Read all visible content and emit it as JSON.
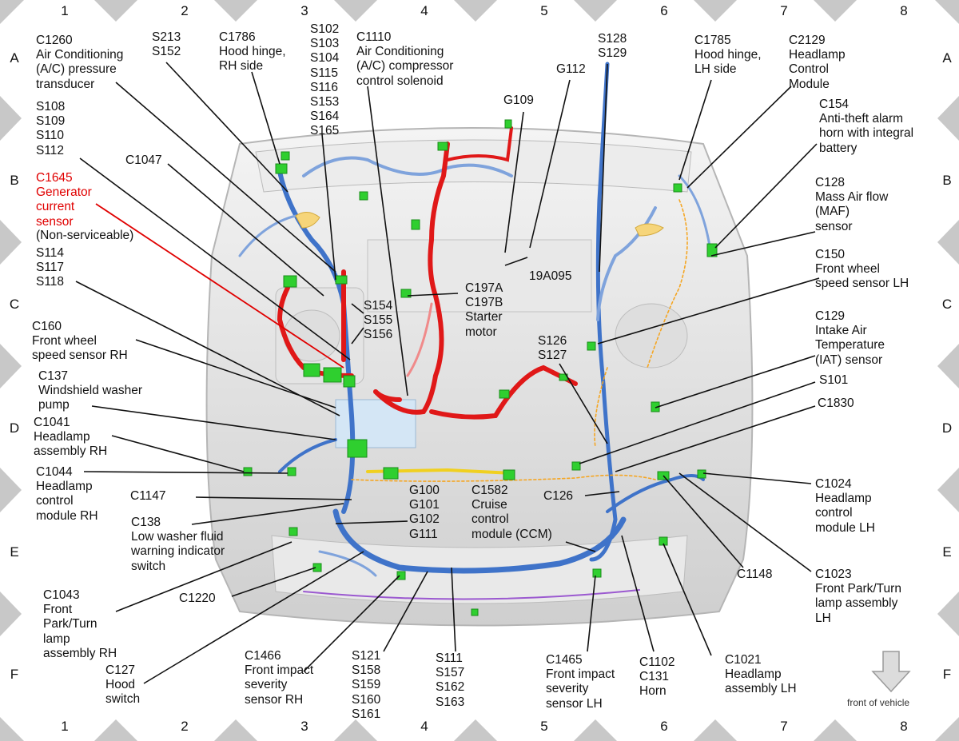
{
  "grid": {
    "columns": [
      "1",
      "2",
      "3",
      "4",
      "5",
      "6",
      "7",
      "8"
    ],
    "rows": [
      "A",
      "B",
      "C",
      "D",
      "E",
      "F"
    ]
  },
  "callouts": {
    "c1260": "C1260\nAir Conditioning\n(A/C) pressure\ntransducer",
    "s213": "S213\nS152",
    "c1786": "C1786\nHood hinge,\nRH side",
    "s102": "S102\nS103\nS104\nS115\nS116\nS153\nS164\nS165",
    "c1110": "C1110\nAir Conditioning\n(A/C) compressor\ncontrol solenoid",
    "g109": "G109",
    "g112": "G112",
    "s128": "S128\nS129",
    "c1785": "C1785\nHood hinge,\nLH side",
    "c2129": "C2129\nHeadlamp\nControl\nModule",
    "s108": "S108\nS109\nS110\nS112",
    "c1047": "C1047",
    "c1645": "C1645\nGenerator\ncurrent\nsensor",
    "c1645_note": "(Non-serviceable)",
    "c154": "C154\nAnti-theft alarm\nhorn with integral\nbattery",
    "c128": "C128\nMass Air flow\n(MAF)\nsensor",
    "s114": "S114\nS117\nS118",
    "a19a095": "19A095",
    "c150": "C150\nFront wheel\nspeed sensor LH",
    "c197": "C197A\nC197B\nStarter\nmotor",
    "s154": "S154\nS155\nS156",
    "c160": "C160\nFront wheel\nspeed sensor RH",
    "c129": "C129\nIntake Air\nTemperature\n(IAT) sensor",
    "s126": "S126\nS127",
    "c137": "C137\nWindshield washer\npump",
    "s101": "S101",
    "c1830": "C1830",
    "c1041": "C1041\nHeadlamp\nassembly RH",
    "c1044": "C1044\nHeadlamp\ncontrol\nmodule RH",
    "c1147": "C1147",
    "g100": "G100\nG101\nG102\nG111",
    "c1582": "C1582\nCruise\ncontrol\nmodule (CCM)",
    "c126": "C126",
    "c1024": "C1024\nHeadlamp\ncontrol\nmodule LH",
    "c138": "C138\nLow washer fluid\nwarning indicator\nswitch",
    "c1148": "C1148",
    "c1023": "C1023\nFront Park/Turn\nlamp assembly\nLH",
    "c1220": "C1220",
    "c1043": "C1043\nFront\nPark/Turn\nlamp\nassembly RH",
    "c127": "C127\nHood\nswitch",
    "c1466": "C1466\nFront impact\nseverity\nsensor RH",
    "s121": "S121\nS158\nS159\nS160\nS161",
    "s111": "S111\nS157\nS162\nS163",
    "c1465": "C1465\nFront impact\nseverity\nsensor LH",
    "c1102": "C1102\nC131\nHorn",
    "c1021": "C1021\nHeadlamp\nassembly LH"
  },
  "legend": {
    "label": "front of vehicle",
    "icon": "arrow-down-icon"
  },
  "colors": {
    "harness_blue": "#3f73c9",
    "harness_blue_light": "#7fa3dc",
    "harness_red": "#e01818",
    "harness_red_light": "#f08a8a",
    "harness_yellow": "#f0d020",
    "harness_orange": "#f5a623",
    "harness_purple": "#9b59d0",
    "connector_green": "#2fcf2f",
    "callout_red": "#e00000",
    "vehicle_body": "#d9d9d9",
    "border_diamond": "#c8c8c8"
  }
}
